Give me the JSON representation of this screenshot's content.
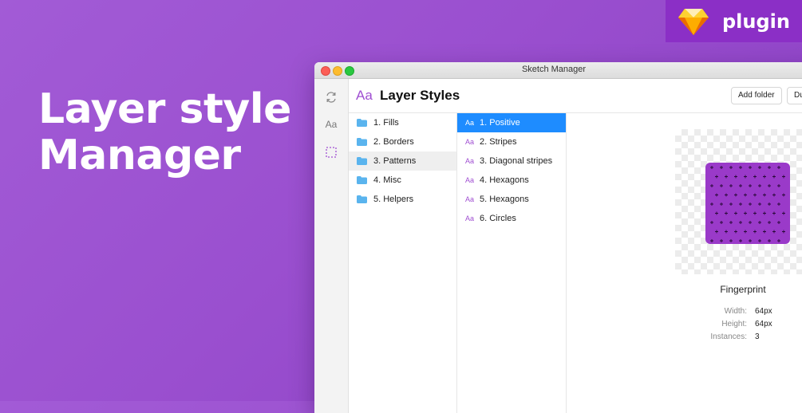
{
  "hero": {
    "line1": "Layer style",
    "line2": "Manager"
  },
  "badge": {
    "label": "plugin",
    "icon": "sketch-gem-icon"
  },
  "window": {
    "title": "Sketch Manager",
    "header": {
      "icon_text": "Aa",
      "title": "Layer Styles",
      "add_folder": "Add folder",
      "dup_partial": "Du"
    }
  },
  "sidebar": {
    "items": [
      "refresh-icon",
      "text-styles-icon",
      "layer-styles-icon"
    ],
    "text_icon_label": "Aa"
  },
  "folders": [
    {
      "label": "1. Fills"
    },
    {
      "label": "2. Borders"
    },
    {
      "label": "3. Patterns",
      "selected": true
    },
    {
      "label": "4. Misc"
    },
    {
      "label": "5. Helpers"
    }
  ],
  "styles": [
    {
      "icon": "Aa",
      "label": "1. Positive",
      "active": true
    },
    {
      "icon": "Aa",
      "label": "2. Stripes"
    },
    {
      "icon": "Aa",
      "label": "3. Diagonal stripes"
    },
    {
      "icon": "Aa",
      "label": "4. Hexagons"
    },
    {
      "icon": "Aa",
      "label": "5. Hexagons"
    },
    {
      "icon": "Aa",
      "label": "6. Circles"
    }
  ],
  "detail": {
    "name": "Fingerprint",
    "props": [
      {
        "label": "Width:",
        "value": "64px"
      },
      {
        "label": "Height:",
        "value": "64px"
      },
      {
        "label": "Instances:",
        "value": "3"
      }
    ]
  },
  "colors": {
    "accent": "#a04fd2",
    "selection": "#1e8cff",
    "swatch": "#9a3ac9",
    "badge": "#8b2fc6"
  }
}
